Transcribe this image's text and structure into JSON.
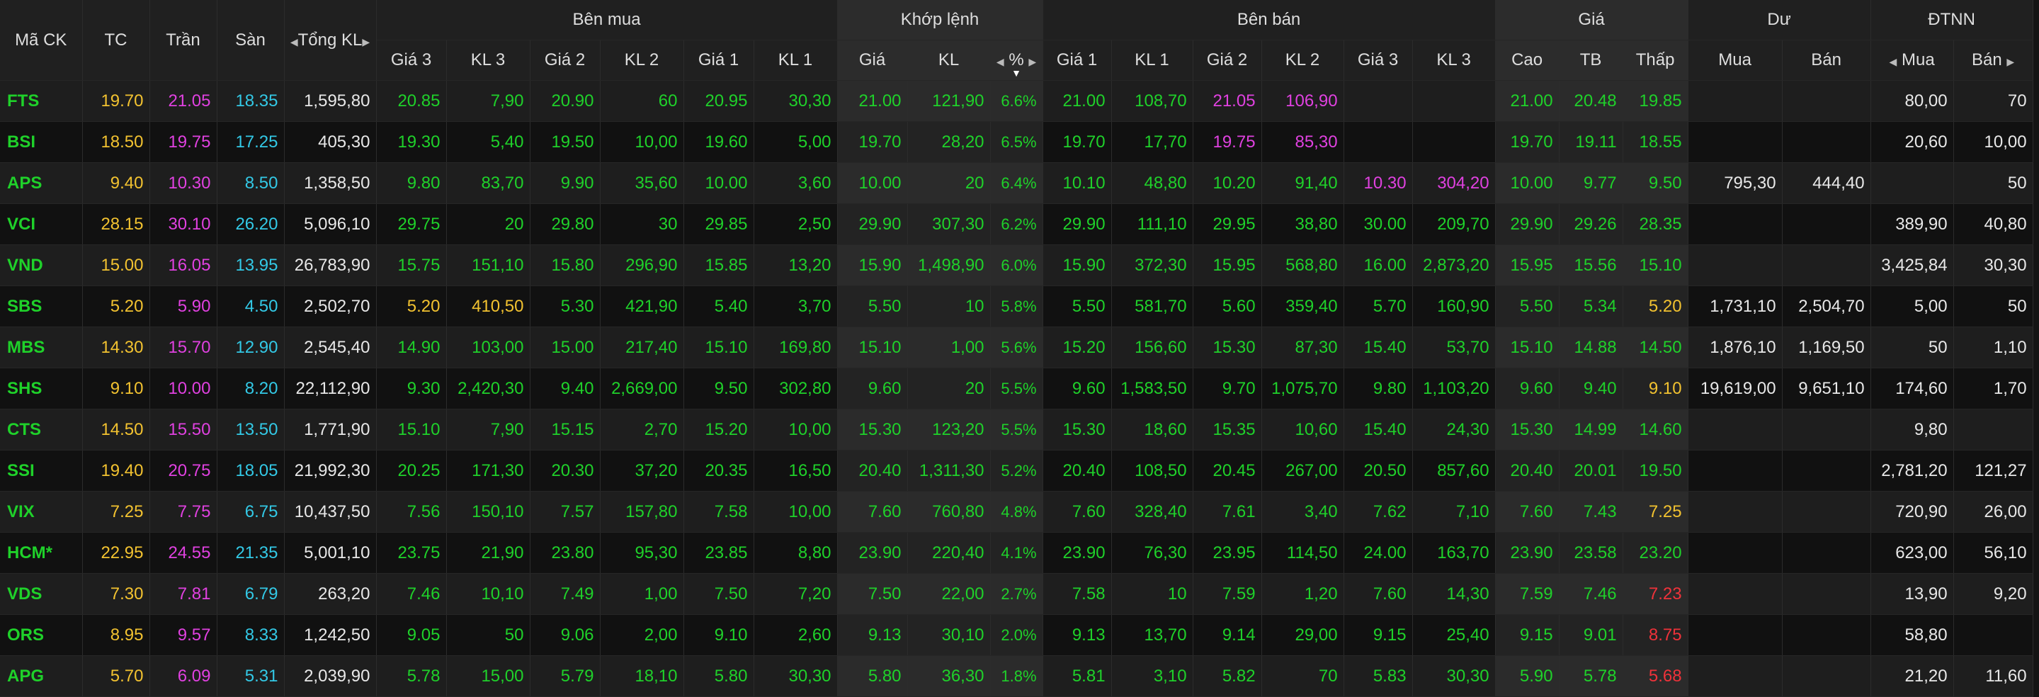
{
  "colors": {
    "up": "#1fd12a",
    "ref": "#f2c230",
    "ceiling": "#e041e0",
    "floor": "#33c9e6",
    "neutral": "#e8e8e8",
    "down": "#f0323a"
  },
  "headers": {
    "ma_ck": "Mã CK",
    "tc": "TC",
    "tran": "Trần",
    "san": "Sàn",
    "tong_kl": "Tổng KL",
    "ben_mua": "Bên mua",
    "khop_lenh": "Khớp lệnh",
    "ben_ban": "Bên bán",
    "gia": "Giá",
    "du": "Dư",
    "dtnn": "ĐTNN",
    "gia3": "Giá 3",
    "kl3": "KL 3",
    "gia2": "Giá 2",
    "kl2": "KL 2",
    "gia1": "Giá 1",
    "kl1": "KL 1",
    "khop_gia": "Giá",
    "khop_kl": "KL",
    "khop_pct": "%",
    "cao": "Cao",
    "tb": "TB",
    "thap": "Thấp",
    "du_mua": "Mua",
    "du_ban": "Bán",
    "nn_mua": "Mua",
    "nn_ban": "Bán"
  },
  "rows": [
    {
      "sym": "FTS",
      "tc": "19.70",
      "tran": "21.05",
      "san": "18.35",
      "tong": "1,595,80",
      "b_g3": "20.85",
      "b_k3": "7,90",
      "b_g2": "20.90",
      "b_k2": "60",
      "b_g1": "20.95",
      "b_k1": "30,30",
      "m_g": "21.00",
      "m_k": "121,90",
      "m_p": "6.6%",
      "s_g1": "21.00",
      "s_k1": "108,70",
      "s_g2": "21.05",
      "s_k2": "106,90",
      "s_g3": "",
      "s_k3": "",
      "cao": "21.00",
      "tb": "20.48",
      "thap": "19.85",
      "du_mua": "",
      "du_ban": "",
      "nn_mua": "80,00",
      "nn_ban": "70"
    },
    {
      "sym": "BSI",
      "tc": "18.50",
      "tran": "19.75",
      "san": "17.25",
      "tong": "405,30",
      "b_g3": "19.30",
      "b_k3": "5,40",
      "b_g2": "19.50",
      "b_k2": "10,00",
      "b_g1": "19.60",
      "b_k1": "5,00",
      "m_g": "19.70",
      "m_k": "28,20",
      "m_p": "6.5%",
      "s_g1": "19.70",
      "s_k1": "17,70",
      "s_g2": "19.75",
      "s_k2": "85,30",
      "s_g3": "",
      "s_k3": "",
      "cao": "19.70",
      "tb": "19.11",
      "thap": "18.55",
      "du_mua": "",
      "du_ban": "",
      "nn_mua": "20,60",
      "nn_ban": "10,00"
    },
    {
      "sym": "APS",
      "tc": "9.40",
      "tran": "10.30",
      "san": "8.50",
      "tong": "1,358,50",
      "b_g3": "9.80",
      "b_k3": "83,70",
      "b_g2": "9.90",
      "b_k2": "35,60",
      "b_g1": "10.00",
      "b_k1": "3,60",
      "m_g": "10.00",
      "m_k": "20",
      "m_p": "6.4%",
      "s_g1": "10.10",
      "s_k1": "48,80",
      "s_g2": "10.20",
      "s_k2": "91,40",
      "s_g3": "10.30",
      "s_k3": "304,20",
      "cao": "10.00",
      "tb": "9.77",
      "thap": "9.50",
      "du_mua": "795,30",
      "du_ban": "444,40",
      "nn_mua": "",
      "nn_ban": "50"
    },
    {
      "sym": "VCI",
      "tc": "28.15",
      "tran": "30.10",
      "san": "26.20",
      "tong": "5,096,10",
      "b_g3": "29.75",
      "b_k3": "20",
      "b_g2": "29.80",
      "b_k2": "30",
      "b_g1": "29.85",
      "b_k1": "2,50",
      "m_g": "29.90",
      "m_k": "307,30",
      "m_p": "6.2%",
      "s_g1": "29.90",
      "s_k1": "111,10",
      "s_g2": "29.95",
      "s_k2": "38,80",
      "s_g3": "30.00",
      "s_k3": "209,70",
      "cao": "29.90",
      "tb": "29.26",
      "thap": "28.35",
      "du_mua": "",
      "du_ban": "",
      "nn_mua": "389,90",
      "nn_ban": "40,80"
    },
    {
      "sym": "VND",
      "tc": "15.00",
      "tran": "16.05",
      "san": "13.95",
      "tong": "26,783,90",
      "b_g3": "15.75",
      "b_k3": "151,10",
      "b_g2": "15.80",
      "b_k2": "296,90",
      "b_g1": "15.85",
      "b_k1": "13,20",
      "m_g": "15.90",
      "m_k": "1,498,90",
      "m_p": "6.0%",
      "s_g1": "15.90",
      "s_k1": "372,30",
      "s_g2": "15.95",
      "s_k2": "568,80",
      "s_g3": "16.00",
      "s_k3": "2,873,20",
      "cao": "15.95",
      "tb": "15.56",
      "thap": "15.10",
      "du_mua": "",
      "du_ban": "",
      "nn_mua": "3,425,84",
      "nn_ban": "30,30"
    },
    {
      "sym": "SBS",
      "tc": "5.20",
      "tran": "5.90",
      "san": "4.50",
      "tong": "2,502,70",
      "b_g3": "5.20",
      "b_k3": "410,50",
      "b_g2": "5.30",
      "b_k2": "421,90",
      "b_g1": "5.40",
      "b_k1": "3,70",
      "m_g": "5.50",
      "m_k": "10",
      "m_p": "5.8%",
      "s_g1": "5.50",
      "s_k1": "581,70",
      "s_g2": "5.60",
      "s_k2": "359,40",
      "s_g3": "5.70",
      "s_k3": "160,90",
      "cao": "5.50",
      "tb": "5.34",
      "thap": "5.20",
      "du_mua": "1,731,10",
      "du_ban": "2,504,70",
      "nn_mua": "5,00",
      "nn_ban": "50"
    },
    {
      "sym": "MBS",
      "tc": "14.30",
      "tran": "15.70",
      "san": "12.90",
      "tong": "2,545,40",
      "b_g3": "14.90",
      "b_k3": "103,00",
      "b_g2": "15.00",
      "b_k2": "217,40",
      "b_g1": "15.10",
      "b_k1": "169,80",
      "m_g": "15.10",
      "m_k": "1,00",
      "m_p": "5.6%",
      "s_g1": "15.20",
      "s_k1": "156,60",
      "s_g2": "15.30",
      "s_k2": "87,30",
      "s_g3": "15.40",
      "s_k3": "53,70",
      "cao": "15.10",
      "tb": "14.88",
      "thap": "14.50",
      "du_mua": "1,876,10",
      "du_ban": "1,169,50",
      "nn_mua": "50",
      "nn_ban": "1,10"
    },
    {
      "sym": "SHS",
      "tc": "9.10",
      "tran": "10.00",
      "san": "8.20",
      "tong": "22,112,90",
      "b_g3": "9.30",
      "b_k3": "2,420,30",
      "b_g2": "9.40",
      "b_k2": "2,669,00",
      "b_g1": "9.50",
      "b_k1": "302,80",
      "m_g": "9.60",
      "m_k": "20",
      "m_p": "5.5%",
      "s_g1": "9.60",
      "s_k1": "1,583,50",
      "s_g2": "9.70",
      "s_k2": "1,075,70",
      "s_g3": "9.80",
      "s_k3": "1,103,20",
      "cao": "9.60",
      "tb": "9.40",
      "thap": "9.10",
      "du_mua": "19,619,00",
      "du_ban": "9,651,10",
      "nn_mua": "174,60",
      "nn_ban": "1,70"
    },
    {
      "sym": "CTS",
      "tc": "14.50",
      "tran": "15.50",
      "san": "13.50",
      "tong": "1,771,90",
      "b_g3": "15.10",
      "b_k3": "7,90",
      "b_g2": "15.15",
      "b_k2": "2,70",
      "b_g1": "15.20",
      "b_k1": "10,00",
      "m_g": "15.30",
      "m_k": "123,20",
      "m_p": "5.5%",
      "s_g1": "15.30",
      "s_k1": "18,60",
      "s_g2": "15.35",
      "s_k2": "10,60",
      "s_g3": "15.40",
      "s_k3": "24,30",
      "cao": "15.30",
      "tb": "14.99",
      "thap": "14.60",
      "du_mua": "",
      "du_ban": "",
      "nn_mua": "9,80",
      "nn_ban": ""
    },
    {
      "sym": "SSI",
      "tc": "19.40",
      "tran": "20.75",
      "san": "18.05",
      "tong": "21,992,30",
      "b_g3": "20.25",
      "b_k3": "171,30",
      "b_g2": "20.30",
      "b_k2": "37,20",
      "b_g1": "20.35",
      "b_k1": "16,50",
      "m_g": "20.40",
      "m_k": "1,311,30",
      "m_p": "5.2%",
      "s_g1": "20.40",
      "s_k1": "108,50",
      "s_g2": "20.45",
      "s_k2": "267,00",
      "s_g3": "20.50",
      "s_k3": "857,60",
      "cao": "20.40",
      "tb": "20.01",
      "thap": "19.50",
      "du_mua": "",
      "du_ban": "",
      "nn_mua": "2,781,20",
      "nn_ban": "121,27"
    },
    {
      "sym": "VIX",
      "tc": "7.25",
      "tran": "7.75",
      "san": "6.75",
      "tong": "10,437,50",
      "b_g3": "7.56",
      "b_k3": "150,10",
      "b_g2": "7.57",
      "b_k2": "157,80",
      "b_g1": "7.58",
      "b_k1": "10,00",
      "m_g": "7.60",
      "m_k": "760,80",
      "m_p": "4.8%",
      "s_g1": "7.60",
      "s_k1": "328,40",
      "s_g2": "7.61",
      "s_k2": "3,40",
      "s_g3": "7.62",
      "s_k3": "7,10",
      "cao": "7.60",
      "tb": "7.43",
      "thap": "7.25",
      "du_mua": "",
      "du_ban": "",
      "nn_mua": "720,90",
      "nn_ban": "26,00"
    },
    {
      "sym": "HCM*",
      "tc": "22.95",
      "tran": "24.55",
      "san": "21.35",
      "tong": "5,001,10",
      "b_g3": "23.75",
      "b_k3": "21,90",
      "b_g2": "23.80",
      "b_k2": "95,30",
      "b_g1": "23.85",
      "b_k1": "8,80",
      "m_g": "23.90",
      "m_k": "220,40",
      "m_p": "4.1%",
      "s_g1": "23.90",
      "s_k1": "76,30",
      "s_g2": "23.95",
      "s_k2": "114,50",
      "s_g3": "24.00",
      "s_k3": "163,70",
      "cao": "23.90",
      "tb": "23.58",
      "thap": "23.20",
      "du_mua": "",
      "du_ban": "",
      "nn_mua": "623,00",
      "nn_ban": "56,10"
    },
    {
      "sym": "VDS",
      "tc": "7.30",
      "tran": "7.81",
      "san": "6.79",
      "tong": "263,20",
      "b_g3": "7.46",
      "b_k3": "10,10",
      "b_g2": "7.49",
      "b_k2": "1,00",
      "b_g1": "7.50",
      "b_k1": "7,20",
      "m_g": "7.50",
      "m_k": "22,00",
      "m_p": "2.7%",
      "s_g1": "7.58",
      "s_k1": "10",
      "s_g2": "7.59",
      "s_k2": "1,20",
      "s_g3": "7.60",
      "s_k3": "14,30",
      "cao": "7.59",
      "tb": "7.46",
      "thap": "7.23",
      "du_mua": "",
      "du_ban": "",
      "nn_mua": "13,90",
      "nn_ban": "9,20"
    },
    {
      "sym": "ORS",
      "tc": "8.95",
      "tran": "9.57",
      "san": "8.33",
      "tong": "1,242,50",
      "b_g3": "9.05",
      "b_k3": "50",
      "b_g2": "9.06",
      "b_k2": "2,00",
      "b_g1": "9.10",
      "b_k1": "2,60",
      "m_g": "9.13",
      "m_k": "30,10",
      "m_p": "2.0%",
      "s_g1": "9.13",
      "s_k1": "13,70",
      "s_g2": "9.14",
      "s_k2": "29,00",
      "s_g3": "9.15",
      "s_k3": "25,40",
      "cao": "9.15",
      "tb": "9.01",
      "thap": "8.75",
      "du_mua": "",
      "du_ban": "",
      "nn_mua": "58,80",
      "nn_ban": ""
    },
    {
      "sym": "APG",
      "tc": "5.70",
      "tran": "6.09",
      "san": "5.31",
      "tong": "2,039,90",
      "b_g3": "5.78",
      "b_k3": "15,00",
      "b_g2": "5.79",
      "b_k2": "18,10",
      "b_g1": "5.80",
      "b_k1": "30,30",
      "m_g": "5.80",
      "m_k": "36,30",
      "m_p": "1.8%",
      "s_g1": "5.81",
      "s_k1": "3,10",
      "s_g2": "5.82",
      "s_k2": "70",
      "s_g3": "5.83",
      "s_k3": "30,30",
      "cao": "5.90",
      "tb": "5.78",
      "thap": "5.68",
      "du_mua": "",
      "du_ban": "",
      "nn_mua": "21,20",
      "nn_ban": "11,60"
    }
  ]
}
